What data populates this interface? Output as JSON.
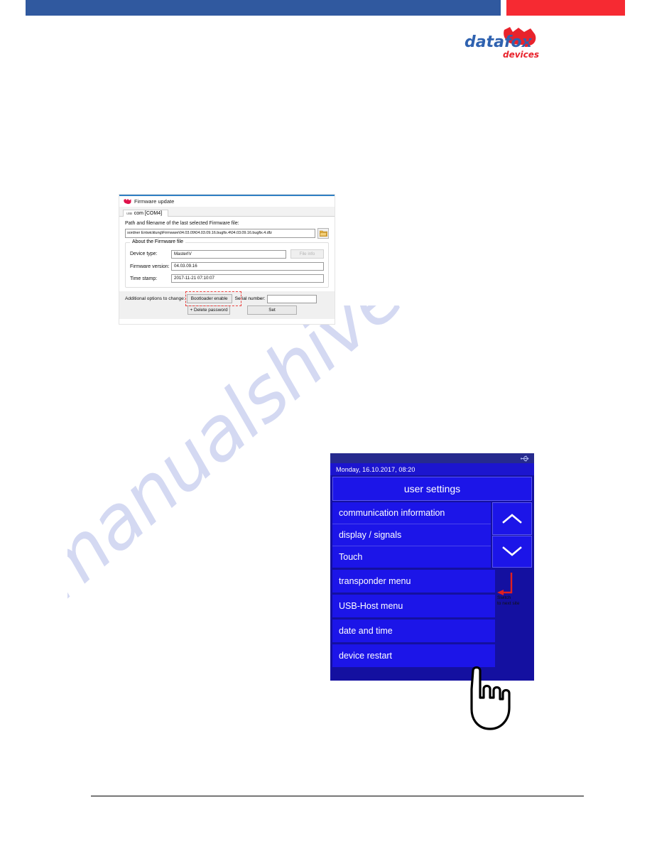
{
  "brand": {
    "logo_text": "datafox:",
    "logo_subtext": "devices",
    "logo_blue": "#2f62b0",
    "logo_red": "#e8232c",
    "bar_blue": "#30599f",
    "bar_red": "#f62a32"
  },
  "watermark": {
    "text": "manualshive.com",
    "color": "#cdd3f0"
  },
  "firmware_dialog": {
    "title": "Firmware update",
    "tab_label": "com [COM4]",
    "tab_icon_text": "USB",
    "path_label": "Path and filename of the last selected Firmware file:",
    "path_value": "sordner Entwicklung\\Firmware\\04.03.09\\04.03.09.16.bugfix.4\\04.03.09.16.bugfix.4.dfz",
    "browse_icon": "folder-icon",
    "fieldset_legend": "About the Firmware file",
    "fields": [
      {
        "label": "Device type:",
        "value": "MasterIV"
      },
      {
        "label": "Firmware version:",
        "value": "04.03.09.16"
      },
      {
        "label": "Time stamp:",
        "value": "2017-11-21 07:10:07"
      }
    ],
    "file_info_button": "File info",
    "options_label": "Additional options to change:",
    "bootloader_button": "Bootloader enable",
    "serial_label": "Serial number:",
    "serial_value": "",
    "delete_password_button": "+ Delete password",
    "set_button": "Set",
    "highlight_color": "#e8413f"
  },
  "device_screen": {
    "status_icon": "usb-icon",
    "datetime": "Monday, 16.10.2017, 08:20",
    "header_title": "user settings",
    "scrollable_items": [
      "communication  information",
      "display / signals",
      "Touch"
    ],
    "menu_items": [
      "transponder  menu",
      "USB-Host menu",
      "date and time",
      "device restart"
    ],
    "scroll_up_icon": "chevron-up-icon",
    "scroll_down_icon": "chevron-down-icon",
    "background": "#1c15e8",
    "topbar_color": "#262a8e"
  },
  "annotation": {
    "switch_caption_line1": "Switch",
    "switch_caption_line2": "to next site",
    "arrow_color": "#e02020",
    "hand_icon": "pointing-hand-icon"
  }
}
